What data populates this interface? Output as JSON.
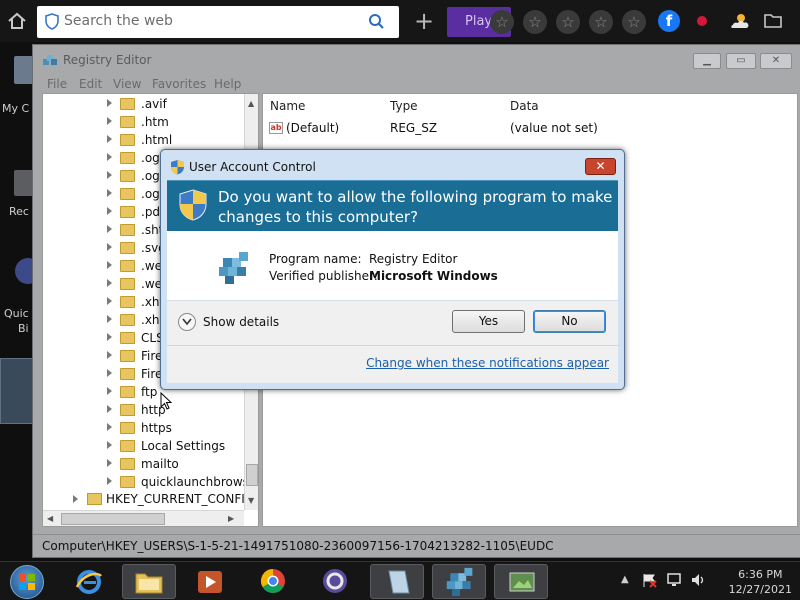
{
  "browser": {
    "search_placeholder": "Search the web",
    "play_label": "Play"
  },
  "desktop": {
    "labels": [
      "My C",
      "Rec",
      "Quic",
      "Bi"
    ]
  },
  "regedit": {
    "title": "Registry Editor",
    "menu": [
      "File",
      "Edit",
      "View",
      "Favorites",
      "Help"
    ],
    "tree_items": [
      ".avif",
      ".htm",
      ".html",
      ".og",
      ".og",
      ".og",
      ".pd",
      ".sht",
      ".svg",
      ".we",
      ".we",
      ".xht",
      ".xht",
      "CLS",
      "Fire",
      "Fire",
      "ftp",
      "http",
      "https",
      "Local Settings",
      "mailto",
      "quicklaunchbrows"
    ],
    "root_item": "HKEY_CURRENT_CONFIG",
    "columns": {
      "name": "Name",
      "type": "Type",
      "data": "Data"
    },
    "rows": [
      {
        "name": "(Default)",
        "type": "REG_SZ",
        "data": "(value not set)"
      }
    ],
    "status_path": "Computer\\HKEY_USERS\\S-1-5-21-1491751080-2360097156-1704213282-1105\\EUDC"
  },
  "uac": {
    "title": "User Account Control",
    "question": "Do you want to allow the following program to make changes to this computer?",
    "program_name_label": "Program name:",
    "program_name": "Registry Editor",
    "publisher_label": "Verified publisher:",
    "publisher": "Microsoft Windows",
    "show_details": "Show details",
    "yes": "Yes",
    "no": "No",
    "link": "Change when these notifications appear"
  },
  "taskbar": {
    "time": "6:36 PM",
    "date": "12/27/2021"
  },
  "colors": {
    "uac_banner": "#1a6e96",
    "link": "#1d5fa8",
    "play": "#5a2ea0"
  }
}
